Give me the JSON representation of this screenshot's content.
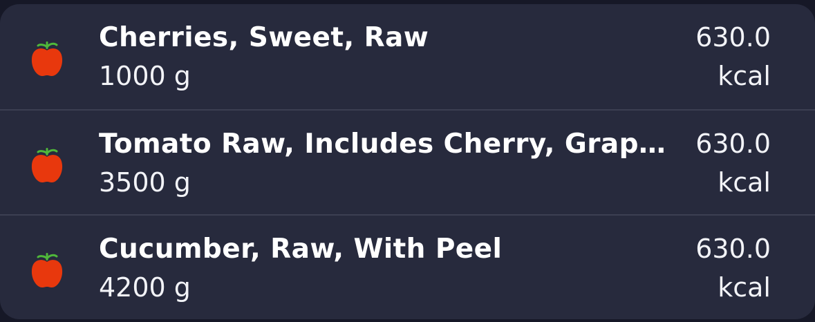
{
  "colors": {
    "background": "#161827",
    "card": "#272a3d",
    "divider": "#3c3f52",
    "text": "#ffffff",
    "apple": "#e8380d",
    "leaf": "#4fb83a"
  },
  "items": [
    {
      "icon": "apple-icon",
      "name": "Cherries, Sweet, Raw",
      "quantity": "1000 g",
      "calories": "630.0",
      "unit": "kcal"
    },
    {
      "icon": "apple-icon",
      "name": "Tomato Raw, Includes Cherry, Grape, …",
      "quantity": "3500 g",
      "calories": "630.0",
      "unit": "kcal"
    },
    {
      "icon": "apple-icon",
      "name": "Cucumber, Raw, With Peel",
      "quantity": "4200 g",
      "calories": "630.0",
      "unit": "kcal"
    }
  ]
}
